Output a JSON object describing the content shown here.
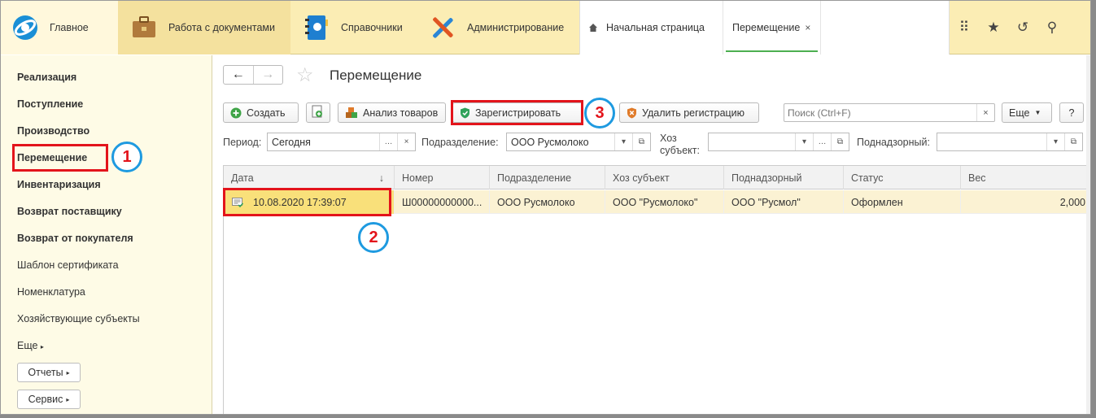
{
  "topbar": {
    "sections": [
      {
        "label": "Главное"
      },
      {
        "label": "Работа с документами"
      },
      {
        "label": "Справочники"
      },
      {
        "label": "Администрирование"
      }
    ],
    "tabs": [
      {
        "label": "Начальная страница"
      },
      {
        "label": "Перемещение",
        "close": "×"
      }
    ],
    "tools": [
      "apps-icon",
      "star-icon",
      "history-icon",
      "search-icon"
    ]
  },
  "sidebar": {
    "items": [
      {
        "label": "Реализация"
      },
      {
        "label": "Поступление"
      },
      {
        "label": "Производство"
      },
      {
        "label": "Перемещение"
      },
      {
        "label": "Инвентаризация"
      },
      {
        "label": "Возврат поставщику"
      },
      {
        "label": "Возврат от покупателя"
      },
      {
        "label": "Шаблон сертификата"
      },
      {
        "label": "Номенклатура"
      },
      {
        "label": "Хозяйствующие субъекты"
      },
      {
        "label": "Еще"
      }
    ],
    "buttons": [
      {
        "label": "Отчеты"
      },
      {
        "label": "Сервис"
      }
    ]
  },
  "form": {
    "title": "Перемещение",
    "toolbar": {
      "create": "Создать",
      "analyze": "Анализ товаров",
      "register": "Зарегистрировать",
      "unregister": "Удалить регистрацию",
      "search_placeholder": "Поиск (Ctrl+F)",
      "more": "Еще",
      "help": "?"
    },
    "filters": {
      "period_label": "Период:",
      "period_value": "Сегодня",
      "dept_label": "Подразделение:",
      "dept_value": "ООО Русмолоко",
      "subject_label": "Хоз субъект:",
      "subject_value": "",
      "supervised_label": "Поднадзорный:",
      "supervised_value": ""
    },
    "grid": {
      "columns": [
        "Дата",
        "Номер",
        "Подразделение",
        "Хоз субъект",
        "Поднадзорный",
        "Статус",
        "Вес"
      ],
      "sort_indicator": "↓",
      "rows": [
        {
          "date": "10.08.2020 17:39:07",
          "number": "Ш00000000000...",
          "dept": "ООО Русмолоко",
          "subject": "ООО \"Русмолоко\"",
          "supervised": "ООО \"Русмол\"",
          "status": "Оформлен",
          "weight": "2,000"
        }
      ]
    }
  },
  "annotations": [
    "1",
    "2",
    "3"
  ],
  "colors": {
    "highlight": "#e3141b",
    "marker_ring": "#1e9ae0",
    "topbar": "#fbedb4",
    "sidebar": "#fefbe6"
  }
}
